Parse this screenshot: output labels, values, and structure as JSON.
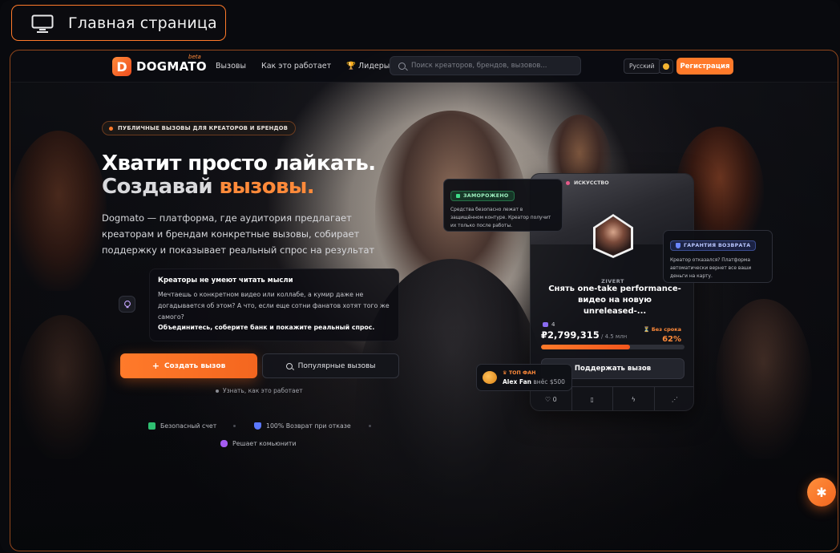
{
  "window": {
    "title": "Главная страница"
  },
  "nav": {
    "logo_letter": "D",
    "logo_text": "DOGMATO",
    "logo_beta": "beta",
    "links": [
      "Вызовы",
      "Как это работает",
      "Лидеры"
    ],
    "search_placeholder": "Поиск креаторов, брендов, вызовов...",
    "language": "Русский",
    "register": "Регистрация"
  },
  "hero": {
    "pill": "ПУБЛИЧНЫЕ ВЫЗОВЫ ДЛЯ КРЕАТОРОВ И БРЕНДОВ",
    "title_line1": "Хватит просто лайкать.",
    "title_line2a": "Создавай ",
    "title_line2b": "вызовы.",
    "description": "Dogmato — платформа, где аудитория предлагает креаторам и брендам конкретные вызовы, собирает поддержку и показывает реальный спрос на результат"
  },
  "problem": {
    "title": "Креаторы не умеют читать мысли",
    "text": "Мечтаешь о конкретном видео или коллабе, а кумир даже не догадывается об этом? А что, если еще сотни фанатов хотят того же самого?",
    "bold": "Объединитесь, соберите банк и покажите реальный спрос."
  },
  "actions": {
    "create": "Создать вызов",
    "popular": "Популярные вызовы",
    "learn": "Узнать, как это работает"
  },
  "trust": [
    "Безопасный счет",
    "100% Возврат при отказе",
    "Решает комьюнити"
  ],
  "card": {
    "category": "ИСКУССТВО",
    "creator": "ZIVERT",
    "title": "Снять one-take performance-видео на новую unreleased-...",
    "backers": "4",
    "amount": "₽2,799,315",
    "goal": " / 4.5 млн",
    "deadline": "Без срока",
    "percent_label": "62%",
    "progress": 0.62,
    "support": "Поддержать вызов",
    "likes": "0"
  },
  "frozen": {
    "badge": "ЗАМОРОЖЕНО",
    "text": "Средства безопасно лежат в защищённом контуре. Креатор получит их только после работы."
  },
  "refund": {
    "badge": "ГАРАНТИЯ ВОЗВРАТА",
    "text": "Креатор отказался? Платформа автоматически вернет все ваши деньги на карту."
  },
  "topfan": {
    "label": "ТОП ФАН",
    "name": "Alex Fan",
    "amount": " внёс $500"
  },
  "colors": {
    "accent": "#ff7a2a",
    "background": "#0b0b0f",
    "frozen": "#3fdc88",
    "refund": "#6a86ff"
  }
}
